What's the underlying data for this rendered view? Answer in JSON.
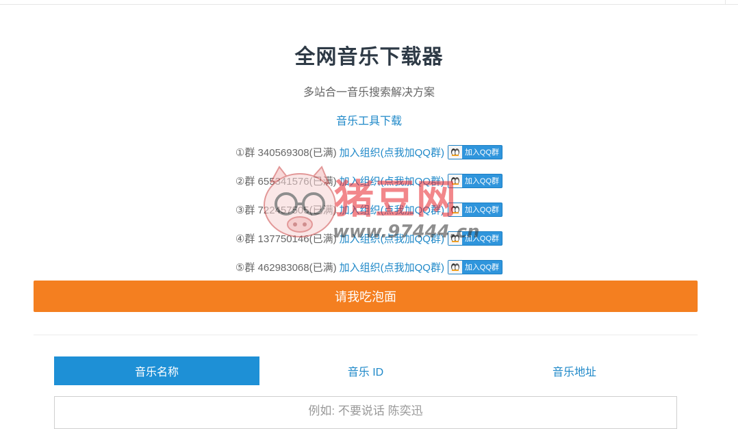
{
  "header": {
    "title": "全网音乐下载器",
    "subtitle": "多站合一音乐搜索解决方案",
    "tool_link": "音乐工具下载"
  },
  "groups": [
    {
      "text": "①群 340569308(已满)",
      "link": "加入组织(点我加QQ群)",
      "badge": "加入QQ群"
    },
    {
      "text": "②群 655341576(已满)",
      "link": "加入组织(点我加QQ群)",
      "badge": "加入QQ群"
    },
    {
      "text": "③群 722457505(已满)",
      "link": "加入组织(点我加QQ群)",
      "badge": "加入QQ群"
    },
    {
      "text": "④群 137750146(已满)",
      "link": "加入组织(点我加QQ群)",
      "badge": "加入QQ群"
    },
    {
      "text": "⑤群 462983068(已满)",
      "link": "加入组织(点我加QQ群)",
      "badge": "加入QQ群"
    }
  ],
  "donate": {
    "label": "请我吃泡面",
    "color": "#f47f20"
  },
  "tabs": [
    {
      "label": "音乐名称",
      "active": true
    },
    {
      "label": "音乐 ID",
      "active": false
    },
    {
      "label": "音乐地址",
      "active": false
    }
  ],
  "search": {
    "placeholder": "例如: 不要说话 陈奕迅"
  },
  "watermark": {
    "brand": "猪豆网",
    "url": "www.97444.cn"
  },
  "colors": {
    "accent": "#1e90d6",
    "link": "#1e88c8",
    "title": "#2e3a46"
  }
}
